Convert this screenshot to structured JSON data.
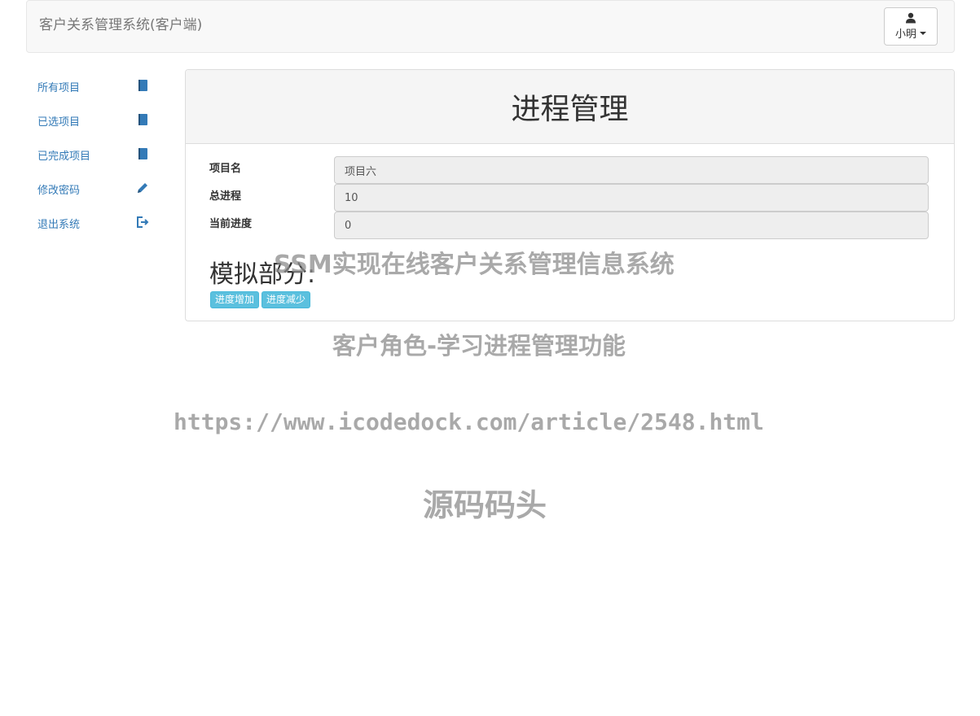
{
  "navbar": {
    "brand": "客户关系管理系统(客户端)",
    "user_name": "小明",
    "icons": {
      "user": "user-icon",
      "caret": "caret-down-icon"
    }
  },
  "sidebar": {
    "items": [
      {
        "label": "所有项目",
        "icon": "book-icon"
      },
      {
        "label": "已选项目",
        "icon": "book-icon"
      },
      {
        "label": "已完成项目",
        "icon": "book-icon"
      },
      {
        "label": "修改密码",
        "icon": "pencil-icon"
      },
      {
        "label": "退出系统",
        "icon": "logout-icon"
      }
    ],
    "link_color": "#337ab7"
  },
  "panel": {
    "title": "进程管理",
    "fields": [
      {
        "label": "项目名",
        "value": "项目六"
      },
      {
        "label": "总进程",
        "value": "10"
      },
      {
        "label": "当前进度",
        "value": "0"
      }
    ],
    "section_title": "模拟部分:",
    "buttons": {
      "increase": "进度增加",
      "decrease": "进度减少"
    },
    "button_color": "#5bc0de"
  },
  "watermarks": {
    "line1": "SSM实现在线客户关系管理信息系统",
    "line2": "客户角色-学习进程管理功能",
    "line3": "https://www.icodedock.com/article/2548.html",
    "line4": "源码码头"
  }
}
